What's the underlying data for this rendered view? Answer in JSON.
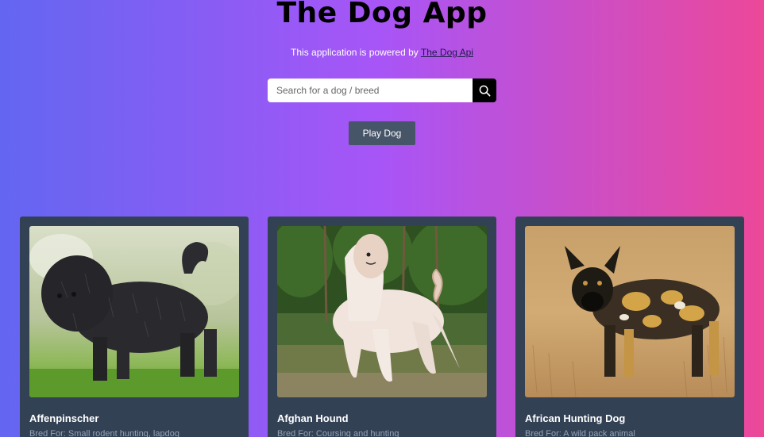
{
  "header": {
    "title": "The Dog App",
    "powered_text": "This application is powered by ",
    "powered_link": "The Dog Api"
  },
  "search": {
    "placeholder": "Search for a dog / breed",
    "value": ""
  },
  "play_button": "Play Dog",
  "bred_prefix": "Bred For: ",
  "colors": {
    "gradient_start": "#6366f1",
    "gradient_mid": "#a855f7",
    "gradient_end": "#ec4899",
    "card_bg": "#334155",
    "button_bg": "#475569"
  },
  "icons": {
    "search": "search-icon"
  },
  "dogs": [
    {
      "name": "Affenpinscher",
      "bred_for": "Small rodent hunting, lapdog"
    },
    {
      "name": "Afghan Hound",
      "bred_for": "Coursing and hunting"
    },
    {
      "name": "African Hunting Dog",
      "bred_for": "A wild pack animal"
    }
  ]
}
